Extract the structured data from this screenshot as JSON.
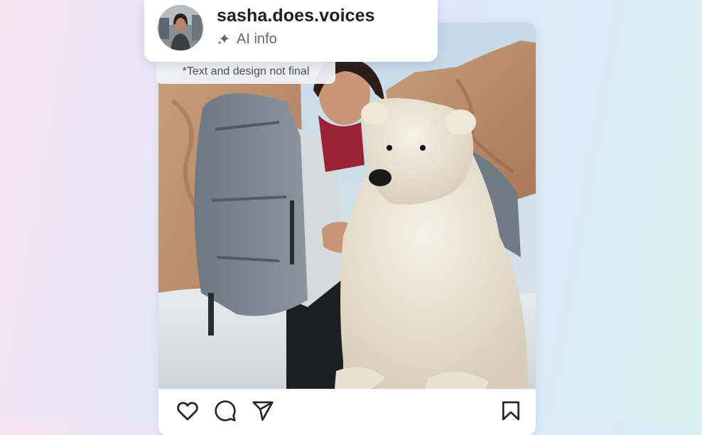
{
  "post": {
    "username": "sasha.does.voices",
    "ai_label": "AI info",
    "disclaimer": "*Text and design not final"
  },
  "icons": {
    "like": "heart-icon",
    "comment": "comment-bubble-icon",
    "share": "paper-plane-icon",
    "save": "bookmark-icon",
    "ai": "sparkle-icon"
  },
  "colors": {
    "text_primary": "#1c1e21",
    "text_secondary": "#65676b",
    "icon": "#262626"
  }
}
